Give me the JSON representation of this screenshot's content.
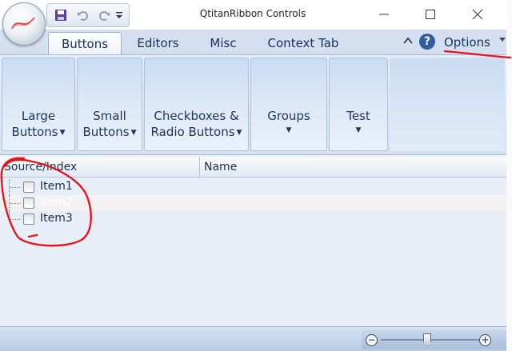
{
  "window": {
    "title": "QtitanRibbon Controls"
  },
  "quick_access": {
    "icons": [
      "save-icon",
      "undo-icon",
      "redo-icon",
      "customize-dropdown-icon"
    ]
  },
  "tabs": [
    {
      "label": "Buttons",
      "active": true
    },
    {
      "label": "Editors",
      "active": false
    },
    {
      "label": "Misc",
      "active": false
    },
    {
      "label": "Context Tab",
      "active": false
    }
  ],
  "options": {
    "label": "Options"
  },
  "ribbon": {
    "buttons": [
      {
        "line1": "Large",
        "line2": "Buttons"
      },
      {
        "line1": "Small",
        "line2": "Buttons"
      },
      {
        "line1": "Checkboxes &",
        "line2": "Radio Buttons"
      },
      {
        "line1": "Groups",
        "line2": ""
      },
      {
        "line1": "Test",
        "line2": ""
      }
    ]
  },
  "tree": {
    "columns": [
      "Source/Index",
      "Name"
    ],
    "items": [
      {
        "label": "Item1",
        "checked": false
      },
      {
        "label": "Item2",
        "checked": false,
        "highlighted": true
      },
      {
        "label": "Item3",
        "checked": false
      }
    ]
  },
  "colors": {
    "accent": "#2f5d9e",
    "annotation": "#e8141c"
  }
}
